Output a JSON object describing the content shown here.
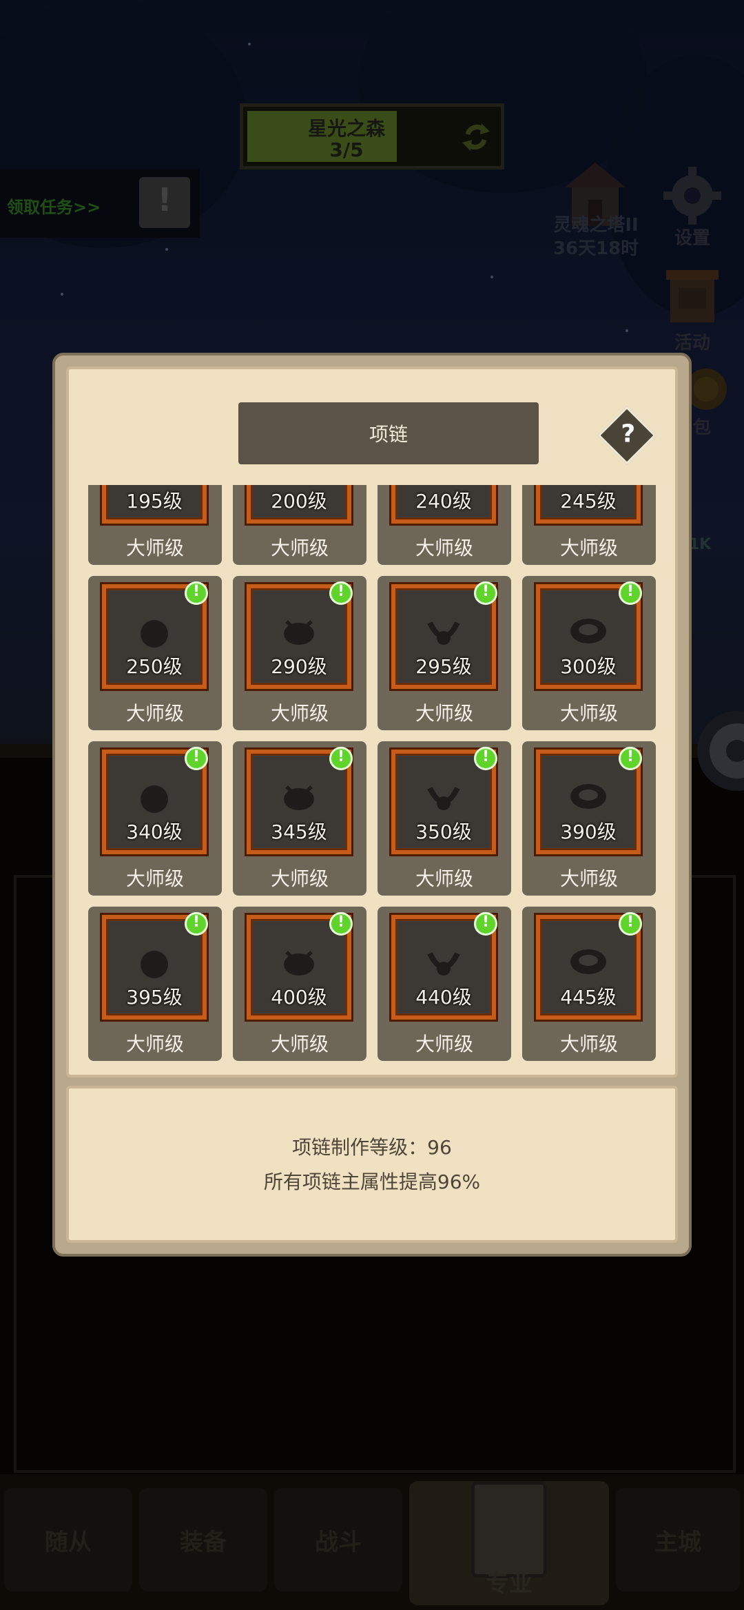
{
  "hud": {
    "stage_name": "星光之森",
    "stage_progress_text": "3/5",
    "stage_progress_fraction": 0.6,
    "quest_label": "领取任务>>",
    "quest_icon": "exclamation-icon",
    "event_name": "灵魂之塔II",
    "event_timer": "36天18时",
    "settings_label": "设置",
    "activity_label": "活动",
    "bag_label_partial": "包",
    "power_partial": "1K"
  },
  "modal": {
    "title": "项链",
    "help_symbol": "?",
    "items": [
      {
        "level": "195级",
        "rank": "大师级",
        "badge": false,
        "icon": "necklace-icon"
      },
      {
        "level": "200级",
        "rank": "大师级",
        "badge": false,
        "icon": "necklace-icon"
      },
      {
        "level": "240级",
        "rank": "大师级",
        "badge": false,
        "icon": "necklace-icon"
      },
      {
        "level": "245级",
        "rank": "大师级",
        "badge": false,
        "icon": "necklace-icon"
      },
      {
        "level": "250级",
        "rank": "大师级",
        "badge": true,
        "icon": "spiral-shell-necklace-icon"
      },
      {
        "level": "290级",
        "rank": "大师级",
        "badge": true,
        "icon": "horned-beetle-necklace-icon"
      },
      {
        "level": "295级",
        "rank": "大师级",
        "badge": true,
        "icon": "claw-necklace-icon"
      },
      {
        "level": "300级",
        "rank": "大师级",
        "badge": true,
        "icon": "ring-necklace-icon"
      },
      {
        "level": "340级",
        "rank": "大师级",
        "badge": true,
        "icon": "tentacle-orb-necklace-icon"
      },
      {
        "level": "345级",
        "rank": "大师级",
        "badge": true,
        "icon": "lantern-necklace-icon"
      },
      {
        "level": "350级",
        "rank": "大师级",
        "badge": true,
        "icon": "snail-necklace-icon"
      },
      {
        "level": "390级",
        "rank": "大师级",
        "badge": true,
        "icon": "horned-skull-necklace-icon"
      },
      {
        "level": "395级",
        "rank": "大师级",
        "badge": true,
        "icon": "gem-cluster-necklace-icon"
      },
      {
        "level": "400级",
        "rank": "大师级",
        "badge": true,
        "icon": "collar-necklace-icon"
      },
      {
        "level": "440级",
        "rank": "大师级",
        "badge": true,
        "icon": "spider-necklace-icon"
      },
      {
        "level": "445级",
        "rank": "大师级",
        "badge": true,
        "icon": "pendant-necklace-icon"
      }
    ],
    "badge_symbol": "!",
    "info_level_line": "项链制作等级：96",
    "info_bonus_line": "所有项链主属性提高96%"
  },
  "nav": {
    "tabs": [
      {
        "label": "随从",
        "active": false
      },
      {
        "label": "装备",
        "active": false
      },
      {
        "label": "战斗",
        "active": false
      },
      {
        "label": "专业",
        "active": true
      },
      {
        "label": "主城",
        "active": false
      }
    ]
  },
  "colors": {
    "card_bg": "#6e6656",
    "frame_orange": "#c65b1a",
    "badge_green": "#5fd52c",
    "parchment": "#f0e1c3",
    "banner": "#5a5346"
  }
}
